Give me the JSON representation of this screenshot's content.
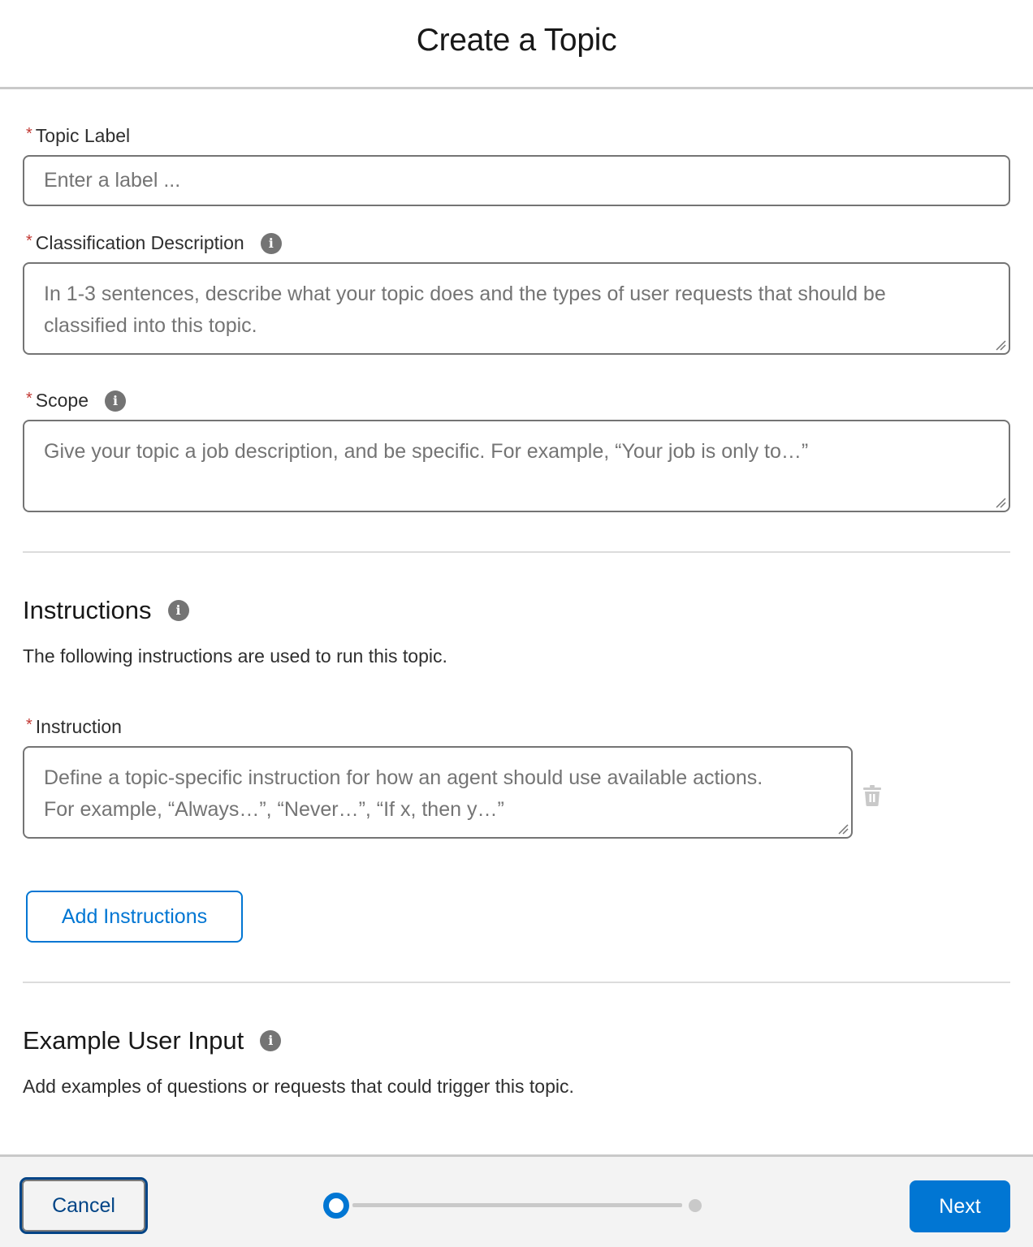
{
  "modal": {
    "title": "Create a Topic"
  },
  "form": {
    "topic_label": {
      "label": "Topic Label",
      "required_marker": "*",
      "placeholder": "Enter a label ...",
      "value": ""
    },
    "classification_description": {
      "label": "Classification Description",
      "required_marker": "*",
      "info_icon": "info-icon",
      "placeholder": "In 1-3 sentences, describe what your topic does and the types of user requests that should be classified into this topic.",
      "value": ""
    },
    "scope": {
      "label": "Scope",
      "required_marker": "*",
      "info_icon": "info-icon",
      "placeholder": "Give your topic a job description, and be specific. For example, “Your job is only to…”",
      "value": ""
    }
  },
  "instructions": {
    "title": "Instructions",
    "info_icon": "info-icon",
    "description": "The following instructions are used to run this topic.",
    "items": [
      {
        "label": "Instruction",
        "required_marker": "*",
        "placeholder": "Define a topic-specific instruction for how an agent should use available actions. For example, “Always…”, “Never…”, “If x, then y…”",
        "value": "",
        "delete_icon": "trash-icon"
      }
    ],
    "add_button_label": "Add Instructions"
  },
  "example_user_input": {
    "title": "Example User Input",
    "info_icon": "info-icon",
    "description": "Add examples of questions or requests that could trigger this topic."
  },
  "footer": {
    "cancel_label": "Cancel",
    "next_label": "Next",
    "progress": {
      "current_step": 1,
      "total_steps": 2
    }
  },
  "colors": {
    "brand": "#0176d3",
    "brand_dark": "#014486",
    "required": "#c23934",
    "info_icon": "#747474",
    "border": "#747474",
    "divider": "#dcdcdc",
    "footer_bg": "#f3f3f3"
  }
}
